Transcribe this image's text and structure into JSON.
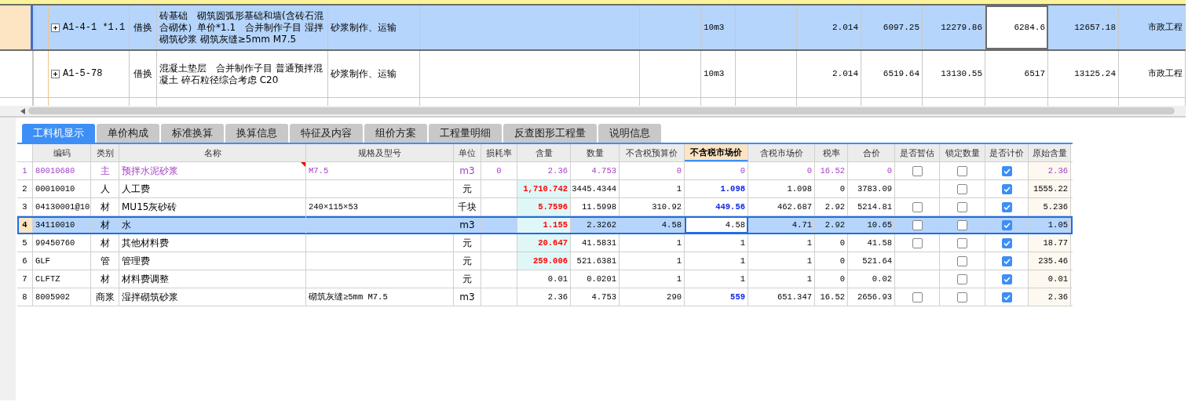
{
  "upper_table": {
    "rows": [
      {
        "selected": true,
        "value_cell_focused": true,
        "expandable": true,
        "column_1": "A1-4-1 *1.1",
        "column_2": "借换",
        "column_3": "砖基础　砌筑圆弧形基础和墙(含砖石混合砌体）单价*1.1　合并制作子目 湿拌砌筑砂浆 砌筑灰缝≥5mm M7.5",
        "column_4": "砂浆制作、运输",
        "column_7": "10m3",
        "column_9": "2.014",
        "column_10": "6097.25",
        "column_11": "12279.86",
        "column_12": "6284.6",
        "column_13": "12657.18",
        "column_14": "市政工程"
      },
      {
        "selected": false,
        "value_cell_focused": false,
        "expandable": true,
        "column_1": "A1-5-78",
        "column_2": "借换",
        "column_3": "混凝土垫层　合并制作子目 普通预拌混凝土 碎石粒径综合考虑 C20",
        "column_4": "砂浆制作、运输",
        "column_7": "10m3",
        "column_9": "2.014",
        "column_10": "6519.64",
        "column_11": "13130.55",
        "column_12": "6517",
        "column_13": "13125.24",
        "column_14": "市政工程"
      }
    ]
  },
  "tabs": [
    {
      "label": "工料机显示",
      "selected": true
    },
    {
      "label": "单价构成",
      "selected": false
    },
    {
      "label": "标准换算",
      "selected": false
    },
    {
      "label": "换算信息",
      "selected": false
    },
    {
      "label": "特征及内容",
      "selected": false
    },
    {
      "label": "组价方案",
      "selected": false
    },
    {
      "label": "工程量明细",
      "selected": false
    },
    {
      "label": "反查图形工程量",
      "selected": false
    },
    {
      "label": "说明信息",
      "selected": false
    }
  ],
  "grid": {
    "columns": [
      {
        "label": "编码",
        "selected": false
      },
      {
        "label": "类别",
        "selected": false
      },
      {
        "label": "名称",
        "selected": false
      },
      {
        "label": "规格及型号",
        "selected": false
      },
      {
        "label": "单位",
        "selected": false
      },
      {
        "label": "损耗率",
        "selected": false
      },
      {
        "label": "含量",
        "selected": false
      },
      {
        "label": "数量",
        "selected": false
      },
      {
        "label": "不含税预算价",
        "selected": false
      },
      {
        "label": "不含税市场价",
        "selected": true
      },
      {
        "label": "含税市场价",
        "selected": false
      },
      {
        "label": "税率",
        "selected": false
      },
      {
        "label": "合价",
        "selected": false
      },
      {
        "label": "是否暂估",
        "selected": false
      },
      {
        "label": "锁定数量",
        "selected": false
      },
      {
        "label": "是否计价",
        "selected": false
      },
      {
        "label": "原始含量",
        "selected": false
      }
    ],
    "rows": [
      {
        "no": "1",
        "kind": "main",
        "selected": false,
        "code": "80010680",
        "type": "主",
        "name": "预拌水泥砂浆",
        "spec": "M7.5",
        "unit": "m3",
        "loss": "0",
        "content": "2.36",
        "content_modified": false,
        "quantity": "4.753",
        "budget_price": "0",
        "market_price": "0",
        "market_price_modified": false,
        "tax_market_price": "0",
        "tax_rate": "16.52",
        "total": "0",
        "provisional": {
          "checked": false
        },
        "locked": false,
        "priced": true,
        "original_content": "2.36"
      },
      {
        "no": "2",
        "kind": "normal",
        "selected": false,
        "code": "00010010",
        "type": "人",
        "name": "人工费",
        "unit": "元",
        "content": "1,710.742",
        "content_modified": true,
        "quantity": "3445.4344",
        "budget_price": "1",
        "market_price": "1.098",
        "market_price_modified": true,
        "tax_market_price": "1.098",
        "tax_rate": "0",
        "total": "3783.09",
        "locked": false,
        "priced": true,
        "original_content": "1555.22"
      },
      {
        "no": "3",
        "kind": "normal",
        "selected": false,
        "code": "04130001@10",
        "type": "材",
        "name": "MU15灰砂砖",
        "spec": "240×115×53",
        "unit": "千块",
        "content": "5.7596",
        "content_modified": true,
        "quantity": "11.5998",
        "budget_price": "310.92",
        "market_price": "449.56",
        "market_price_modified": true,
        "tax_market_price": "462.687",
        "tax_rate": "2.92",
        "total": "5214.81",
        "provisional": {
          "checked": false
        },
        "locked": false,
        "priced": true,
        "original_content": "5.236"
      },
      {
        "no": "4",
        "kind": "normal",
        "selected": true,
        "code": "34110010",
        "type": "材",
        "name": "水",
        "unit": "m3",
        "content": "1.155",
        "content_modified": true,
        "quantity": "2.3262",
        "budget_price": "4.58",
        "market_price": "4.58",
        "market_price_modified": false,
        "tax_market_price": "4.71",
        "tax_rate": "2.92",
        "total": "10.65",
        "provisional": {
          "checked": false
        },
        "locked": false,
        "priced": true,
        "original_content": "1.05"
      },
      {
        "no": "5",
        "kind": "normal",
        "selected": false,
        "code": "99450760",
        "type": "材",
        "name": "其他材料费",
        "unit": "元",
        "content": "20.647",
        "content_modified": true,
        "quantity": "41.5831",
        "budget_price": "1",
        "market_price": "1",
        "market_price_modified": false,
        "tax_market_price": "1",
        "tax_rate": "0",
        "total": "41.58",
        "provisional": {
          "checked": false
        },
        "locked": false,
        "priced": true,
        "original_content": "18.77"
      },
      {
        "no": "6",
        "kind": "normal",
        "selected": false,
        "code": "GLF",
        "type": "管",
        "name": "管理费",
        "unit": "元",
        "content": "259.006",
        "content_modified": true,
        "quantity": "521.6381",
        "budget_price": "1",
        "market_price": "1",
        "market_price_modified": false,
        "tax_market_price": "1",
        "tax_rate": "0",
        "total": "521.64",
        "locked": false,
        "priced": true,
        "original_content": "235.46"
      },
      {
        "no": "7",
        "kind": "normal",
        "selected": false,
        "code": "CLFTZ",
        "type": "材",
        "name": "材料费调整",
        "unit": "元",
        "content": "0.01",
        "content_modified": false,
        "quantity": "0.0201",
        "budget_price": "1",
        "market_price": "1",
        "market_price_modified": false,
        "tax_market_price": "1",
        "tax_rate": "0",
        "total": "0.02",
        "locked": false,
        "priced": true,
        "original_content": "0.01"
      },
      {
        "no": "8",
        "kind": "normal",
        "selected": false,
        "code": "8005902",
        "type": "商浆",
        "name": "湿拌砌筑砂浆",
        "spec": "砌筑灰缝≥5mm M7.5",
        "unit": "m3",
        "content": "2.36",
        "content_modified": false,
        "quantity": "4.753",
        "budget_price": "290",
        "market_price": "559",
        "market_price_modified": true,
        "tax_market_price": "651.347",
        "tax_rate": "16.52",
        "total": "2656.93",
        "provisional": {
          "checked": false
        },
        "locked": false,
        "priced": true,
        "original_content": "2.36"
      }
    ]
  }
}
